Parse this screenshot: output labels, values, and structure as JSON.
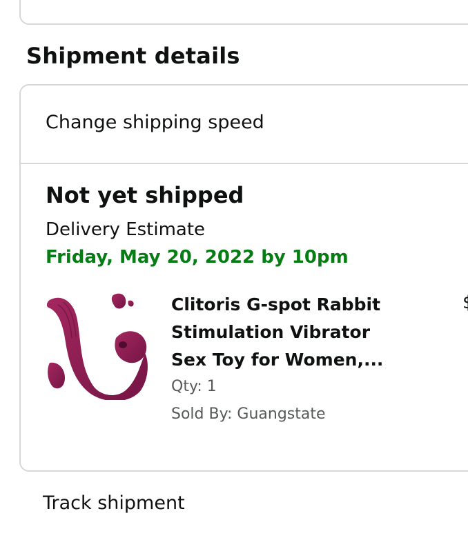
{
  "section": {
    "title": "Shipment details"
  },
  "shipment": {
    "change_speed_label": "Change shipping speed",
    "status": "Not yet shipped",
    "delivery_label": "Delivery Estimate",
    "delivery_date": "Friday, May 20, 2022 by 10pm",
    "product": {
      "title_lines": [
        "Clitoris G-spot Rabbit",
        "Stimulation Vibrator",
        "Sex Toy for Women,..."
      ],
      "qty": "Qty: 1",
      "sold_by": "Sold By: Guangstate",
      "price_fragment": "$"
    },
    "track_label": "Track shipment"
  },
  "colors": {
    "delivery_green": "#067d14",
    "product_magenta": "#8a1d52",
    "border": "#d5d9d9"
  }
}
